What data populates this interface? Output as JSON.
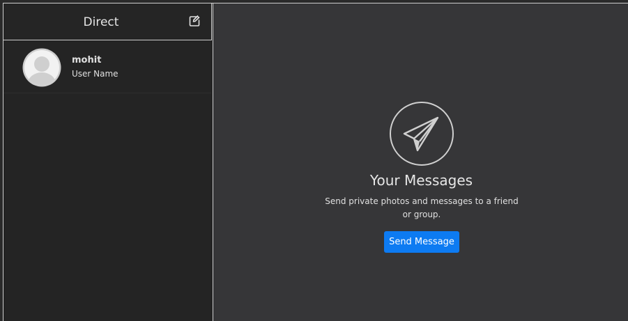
{
  "sidebar": {
    "title": "Direct",
    "compose_icon": "edit-icon",
    "conversations": [
      {
        "name": "mohit",
        "subtitle": "User Name",
        "avatar_icon": "user-avatar-icon"
      }
    ]
  },
  "main": {
    "icon": "paper-plane-icon",
    "title": "Your Messages",
    "description": "Send private photos and messages to a friend or group.",
    "button_label": "Send Message"
  },
  "colors": {
    "background": "#363638",
    "sidebar": "#242424",
    "accent": "#0d7bf2",
    "text": "#e0e0e0"
  }
}
